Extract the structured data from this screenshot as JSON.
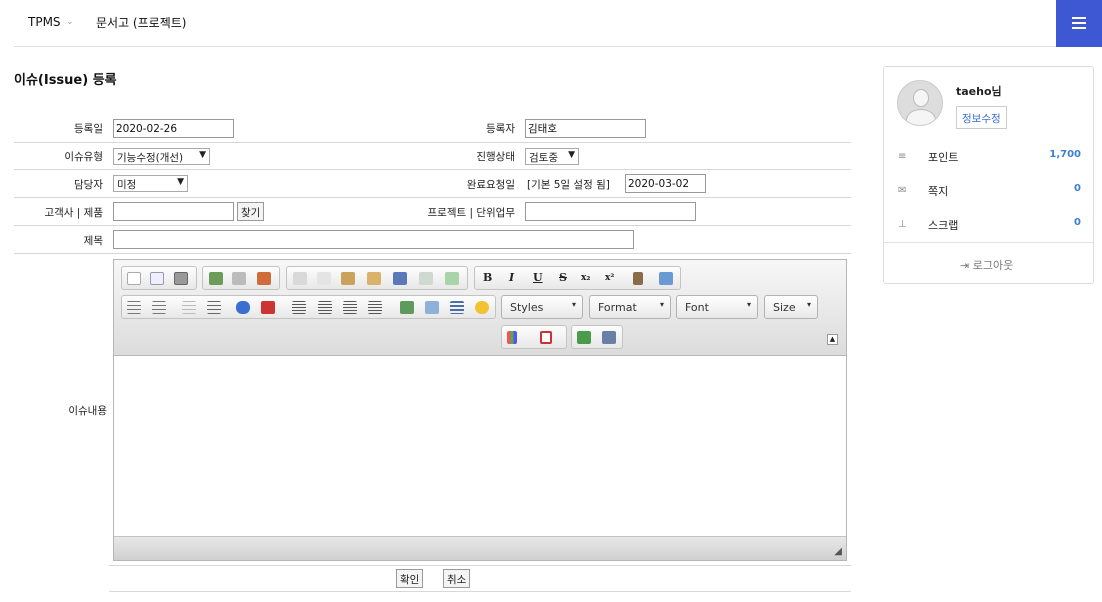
{
  "nav": {
    "brand": "TPMS",
    "caret": "⌄",
    "doc_menu": "문서고 (프로젝트)"
  },
  "page_title": "이슈(Issue) 등록",
  "form": {
    "reg_date_label": "등록일",
    "reg_date_value": "2020-02-26",
    "registrant_label": "등록자",
    "registrant_value": "김태호",
    "issue_type_label": "이슈유형",
    "issue_type_value": "기능수정(개선)",
    "status_label": "진행상태",
    "status_value": "검토중",
    "assignee_label": "담당자",
    "assignee_value": "미정",
    "due_label": "완료요청일",
    "due_hint": "[기본 5일 설정 됨]",
    "due_value": "2020-03-02",
    "customer_label": "고객사 | 제품",
    "customer_value": "",
    "find_button": "찾기",
    "project_label": "프로젝트 | 단위업무",
    "project_value": "",
    "subject_label": "제목",
    "subject_value": "",
    "content_label": "이슈내용",
    "confirm_button": "확인",
    "cancel_button": "취소",
    "select_arrow": "▼"
  },
  "editor": {
    "styles_label": "Styles",
    "format_label": "Format",
    "font_label": "Font",
    "size_label": "Size",
    "bold": "B",
    "italic": "I",
    "underline": "U",
    "strike": "S",
    "subscript": "x₂",
    "superscript": "x²",
    "combo_arrow": "▾",
    "collapse": "▲",
    "resize": "◢"
  },
  "sidebar": {
    "user_name": "taeho님",
    "edit_info": "정보수정",
    "points_label": "포인트",
    "points_value": "1,700",
    "messages_label": "쪽지",
    "messages_value": "0",
    "scrap_label": "스크랩",
    "scrap_value": "0",
    "logout": "로그아웃"
  },
  "colors": {
    "menu_button": "#3e57d3",
    "link": "#3a7fd1"
  }
}
